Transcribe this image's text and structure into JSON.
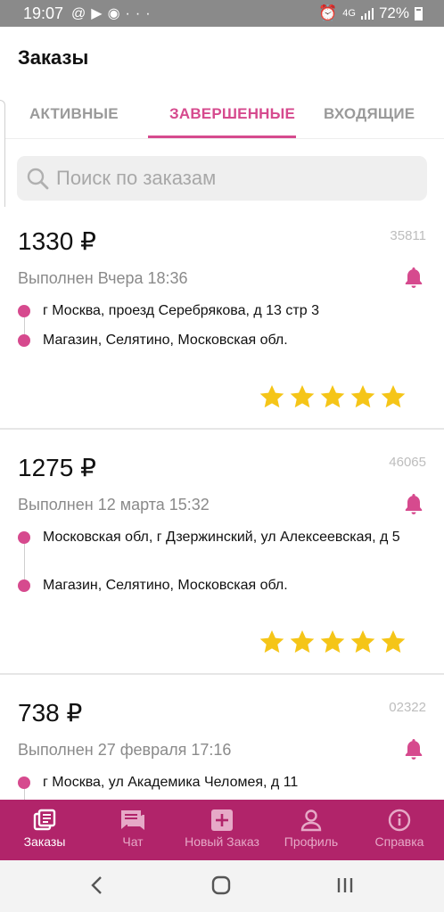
{
  "status_bar": {
    "time": "19:07",
    "left_icons": [
      "at-icon",
      "youtube-icon",
      "chrome-icon",
      "more-icon"
    ],
    "more_glyph": "···",
    "network": "4G",
    "battery": "72%"
  },
  "header": {
    "title": "Заказы"
  },
  "tabs": [
    {
      "label": "АКТИВНЫЕ",
      "active": false
    },
    {
      "label": "ЗАВЕРШЕННЫЕ",
      "active": true
    },
    {
      "label": "ВХОДЯЩИЕ",
      "active": false
    }
  ],
  "search": {
    "placeholder": "Поиск по заказам",
    "value": ""
  },
  "orders": [
    {
      "price": "1330 ₽",
      "number": "35811",
      "status": "Выполнен Вчера 18:36",
      "from": "г Москва, проезд Серебрякова, д 13 стр 3",
      "to": "Магазин, Селятино, Московская обл.",
      "rating": 5
    },
    {
      "price": "1275 ₽",
      "number": "46065",
      "status": "Выполнен 12 марта 15:32",
      "from": "Московская обл, г Дзержинский, ул Алексеевская, д 5",
      "to": "Магазин, Селятино, Московская обл.",
      "rating": 5
    },
    {
      "price": "738 ₽",
      "number": "02322",
      "status": "Выполнен 27 февраля 17:16",
      "from": "г Москва, ул Академика Челомея, д 11",
      "to": "",
      "rating": null
    }
  ],
  "bottom_nav": [
    {
      "label": "Заказы",
      "icon": "orders-icon",
      "active": true
    },
    {
      "label": "Чат",
      "icon": "chat-icon",
      "active": false
    },
    {
      "label": "Новый Заказ",
      "icon": "add-box-icon",
      "active": false
    },
    {
      "label": "Профиль",
      "icon": "profile-icon",
      "active": false
    },
    {
      "label": "Справка",
      "icon": "info-icon",
      "active": false
    }
  ],
  "colors": {
    "accent": "#d64a8e",
    "nav_bg": "#b1246a",
    "star": "#f5c518",
    "status_bar": "#8a8a8a"
  }
}
